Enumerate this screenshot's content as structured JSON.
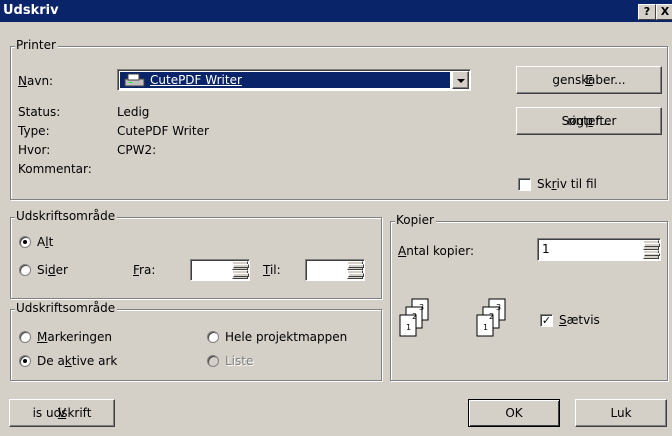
{
  "window": {
    "title": "Udskriv",
    "help_button": "?",
    "close_button": "X"
  },
  "printer": {
    "group_label": "Printer",
    "name_label_pre": "",
    "name_label_u": "N",
    "name_label_post": "avn:",
    "selected_printer": "CutePDF Writer",
    "status_label": "Status:",
    "status_value": "Ledig",
    "type_label": "Type:",
    "type_value": "CutePDF Writer",
    "where_label": "Hvor:",
    "where_value": "CPW2:",
    "comment_label": "Kommentar:",
    "properties_pre": "",
    "properties_u": "E",
    "properties_post": "genskaber...",
    "find_pre": "Søg efter ",
    "find_u": "p",
    "find_post": "rinter...",
    "print_to_file_pre": "Sk",
    "print_to_file_u": "r",
    "print_to_file_post": "iv til fil",
    "print_to_file_checked": false
  },
  "print_range": {
    "group_label": "Udskriftsområde",
    "all_pre": "A",
    "all_u": "l",
    "all_post": "t",
    "pages_pre": "Si",
    "pages_u": "d",
    "pages_post": "er",
    "from_pre": "",
    "from_u": "F",
    "from_post": "ra:",
    "to_pre": "",
    "to_u": "T",
    "to_post": "il:",
    "from_value": "",
    "to_value": "",
    "selected": "all"
  },
  "print_what": {
    "group_label": "Udskriftsområde",
    "selection_pre": "",
    "selection_u": "M",
    "selection_post": "arkeringen",
    "workbook_pre": "Hele pro",
    "workbook_u": "j",
    "workbook_post": "ektmappen",
    "active_pre": "De a",
    "active_u": "k",
    "active_post": "tive ark",
    "list_label": "Liste",
    "selected": "active"
  },
  "copies": {
    "group_label": "Kopier",
    "count_pre": "",
    "count_u": "A",
    "count_post": "ntal kopier:",
    "count_value": "1",
    "collate_pre": "",
    "collate_u": "S",
    "collate_post": "ætvis",
    "collate_checked": true
  },
  "footer": {
    "preview_pre": "",
    "preview_u": "V",
    "preview_post": "is udskrift",
    "ok_label": "OK",
    "close_label": "Luk"
  }
}
